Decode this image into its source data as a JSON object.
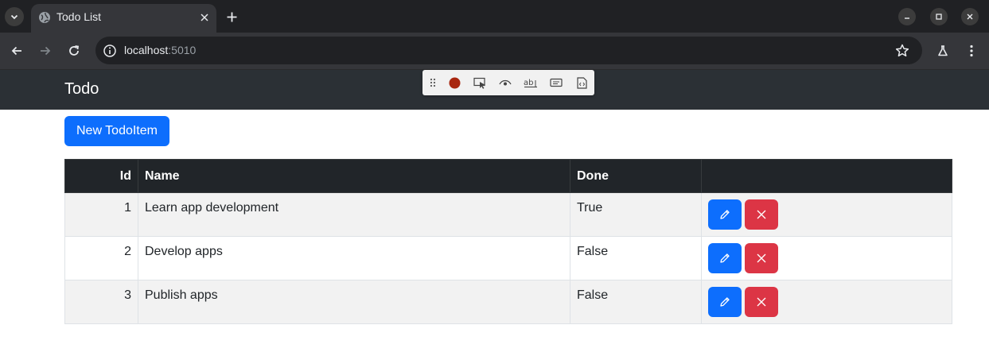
{
  "browser": {
    "tab": {
      "title": "Todo List"
    },
    "address": {
      "host": "localhost",
      "port": ":5010"
    }
  },
  "app": {
    "brand": "Todo",
    "new_button_label": "New TodoItem"
  },
  "table": {
    "headers": {
      "id": "Id",
      "name": "Name",
      "done": "Done"
    },
    "rows": [
      {
        "id": "1",
        "name": "Learn app development",
        "done": "True"
      },
      {
        "id": "2",
        "name": "Develop apps",
        "done": "False"
      },
      {
        "id": "3",
        "name": "Publish apps",
        "done": "False"
      }
    ]
  },
  "colors": {
    "primary": "#0d6efd",
    "danger": "#dc3545",
    "navbar": "#2b3035",
    "table_header": "#212529"
  },
  "icons": {
    "row_edit": "pencil-icon",
    "row_delete": "close-icon"
  }
}
